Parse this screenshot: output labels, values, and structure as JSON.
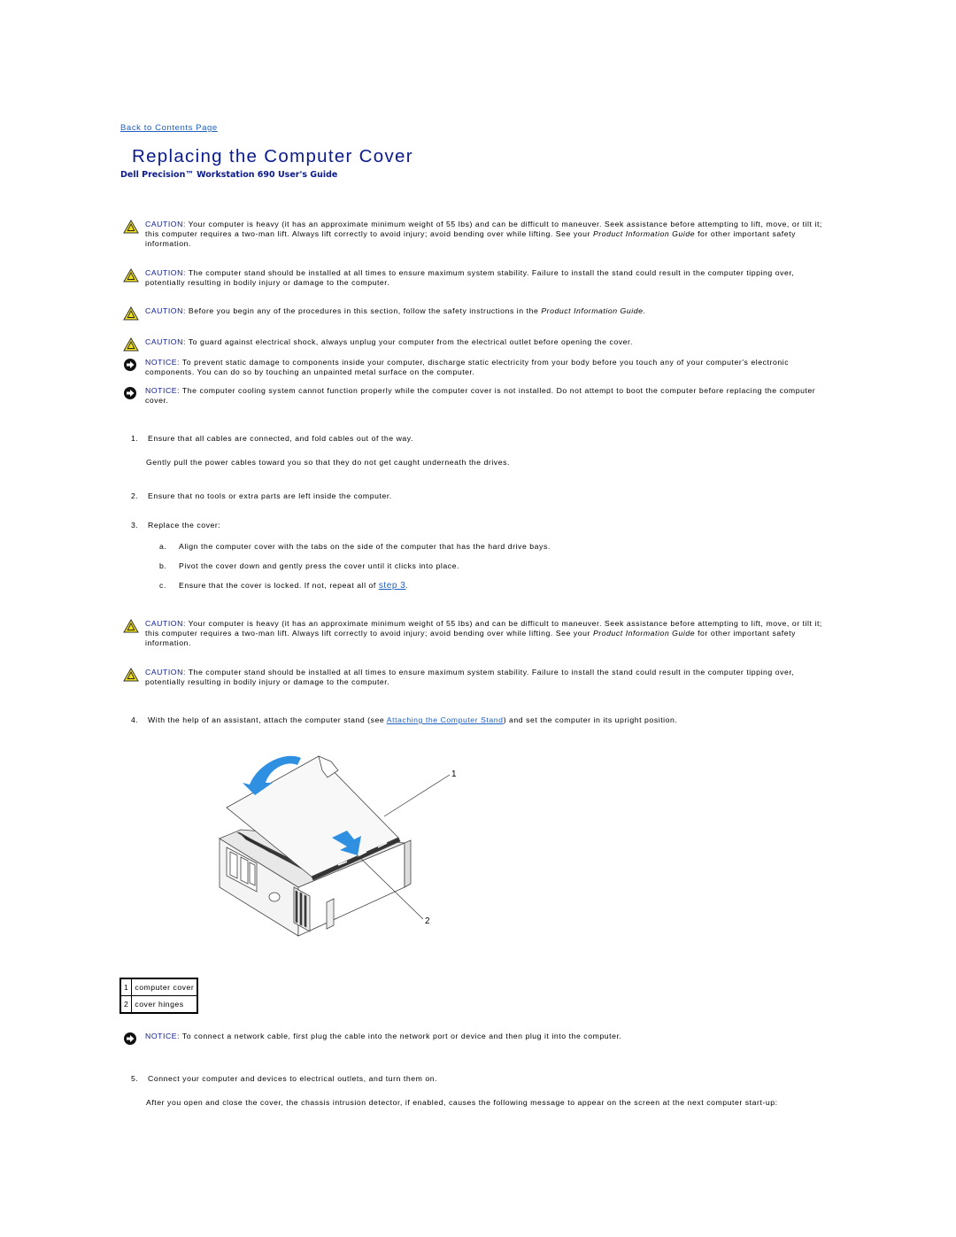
{
  "nav": {
    "back_link": "Back to Contents Page"
  },
  "header": {
    "title": "Replacing the Computer Cover",
    "subtitle": "Dell Precision™ Workstation 690 User's Guide"
  },
  "notes_top": [
    {
      "type": "caution",
      "label": "CAUTION:",
      "text_pre": " Your computer is heavy (it has an approximate minimum weight of 55 lbs) and can be difficult to maneuver. Seek assistance before attempting to lift, move, or tilt it; this computer requires a two-man lift. Always lift correctly to avoid injury; avoid bending over while lifting. See your ",
      "italic": "Product Information Guide",
      "text_post": " for other important safety information."
    },
    {
      "type": "caution",
      "label": "CAUTION:",
      "text_pre": " The computer stand should be installed at all times to ensure maximum system stability. Failure to install the stand could result in the computer tipping over, potentially resulting in bodily injury or damage to the computer.",
      "italic": "",
      "text_post": ""
    },
    {
      "type": "caution",
      "label": "CAUTION:",
      "text_pre": " Before you begin any of the procedures in this section, follow the safety instructions in the ",
      "italic": "Product Information Guide",
      "text_post": "."
    },
    {
      "type": "caution",
      "label": "CAUTION:",
      "text_pre": " To guard against electrical shock, always unplug your computer from the electrical outlet before opening the cover.",
      "italic": "",
      "text_post": ""
    },
    {
      "type": "notice",
      "label": "NOTICE:",
      "text_pre": " To prevent static damage to components inside your computer, discharge static electricity from your body before you touch any of your computer's electronic components. You can do so by touching an unpainted metal surface on the computer.",
      "italic": "",
      "text_post": ""
    },
    {
      "type": "notice",
      "label": "NOTICE:",
      "text_pre": " The computer cooling system cannot function properly while the computer cover is not installed. Do not attempt to boot the computer before replacing the computer cover.",
      "italic": "",
      "text_post": ""
    }
  ],
  "steps": {
    "s1": {
      "num": "1.",
      "text": "Ensure that all cables are connected, and fold cables out of the way.",
      "detail": "Gently pull the power cables toward you so that they do not get caught underneath the drives."
    },
    "s2": {
      "num": "2.",
      "text": "Ensure that no tools or extra parts are left inside the computer."
    },
    "s3": {
      "num": "3.",
      "text": "Replace the cover:",
      "substeps": [
        {
          "num": "a.",
          "text": "Align the computer cover with the tabs on the side of the computer that has the hard drive bays."
        },
        {
          "num": "b.",
          "text": "Pivot the cover down and gently press the cover until it clicks into place."
        },
        {
          "num": "c.",
          "text": "Ensure that the cover is locked. If not, repeat all of ",
          "link": "step 3",
          "text_post": "."
        }
      ]
    },
    "s4": {
      "num": "4.",
      "text_pre": "With the help of an assistant, attach the computer stand (see ",
      "link": "Attaching the Computer Stand",
      "text_post": ") and set the computer in its upright position."
    },
    "s5": {
      "num": "5.",
      "text": "Connect your computer and devices to electrical outlets, and turn them on.",
      "detail": "After you open and close the cover, the chassis intrusion detector, if enabled, causes the following message to appear on the screen at the next computer start-up:"
    }
  },
  "notes_mid": [
    {
      "type": "caution",
      "label": "CAUTION:",
      "text_pre": " Your computer is heavy (it has an approximate minimum weight of 55 lbs) and can be difficult to maneuver. Seek assistance before attempting to lift, move, or tilt it; this computer requires a two-man lift. Always lift correctly to avoid injury; avoid bending over while lifting. See your ",
      "italic": "Product Information Guide",
      "text_post": " for other important safety information."
    },
    {
      "type": "caution",
      "label": "CAUTION:",
      "text_pre": " The computer stand should be installed at all times to ensure maximum system stability. Failure to install the stand could result in the computer tipping over, potentially resulting in bodily injury or damage to the computer.",
      "italic": "",
      "text_post": ""
    }
  ],
  "figure": {
    "callout_1": "1",
    "callout_2": "2"
  },
  "legend": [
    {
      "num": "1",
      "label": "computer cover"
    },
    {
      "num": "2",
      "label": "cover hinges"
    }
  ],
  "notes_bottom": [
    {
      "type": "notice",
      "label": "NOTICE:",
      "text_pre": " To connect a network cable, first plug the cable into the network port or device and then plug it into the computer.",
      "italic": "",
      "text_post": ""
    }
  ],
  "colors": {
    "heading": "#0b1a8c",
    "link": "#1f5fbf",
    "caution_fill": "#f2e21a",
    "arrow_blue": "#2f8fe0"
  }
}
